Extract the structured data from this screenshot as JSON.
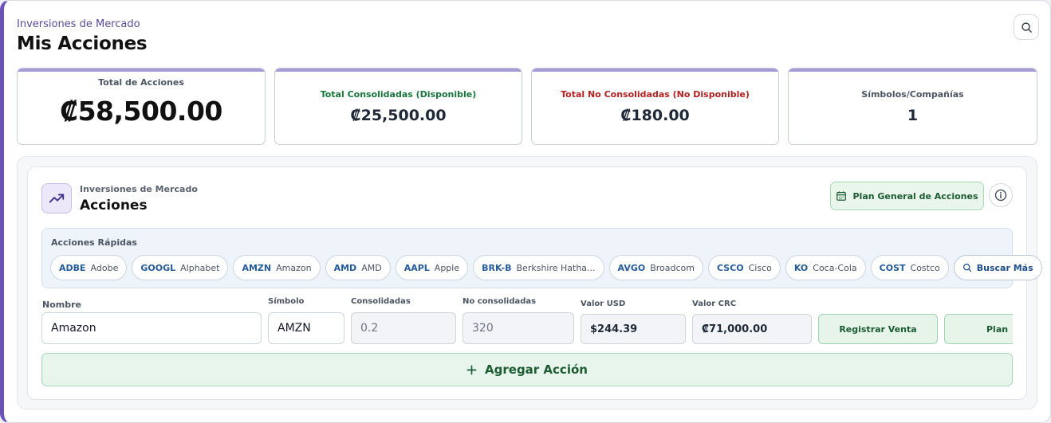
{
  "header": {
    "eyebrow": "Inversiones de Mercado",
    "title": "Mis Acciones"
  },
  "summary": {
    "total_label": "Total de Acciones",
    "total_value": "₡58,500.00",
    "consolidated_label": "Total Consolidadas (Disponible)",
    "consolidated_value": "₡25,500.00",
    "unconsolidated_label": "Total No Consolidadas (No Disponible)",
    "unconsolidated_value": "₡180.00",
    "symbols_label": "Símbolos/Compañías",
    "symbols_value": "1"
  },
  "panel": {
    "eyebrow": "Inversiones de Mercado",
    "title": "Acciones",
    "plan_button": "Plan General de Acciones"
  },
  "quick": {
    "label": "Acciones Rápidas",
    "chips": [
      {
        "symbol": "ADBE",
        "name": "Adobe"
      },
      {
        "symbol": "GOOGL",
        "name": "Alphabet"
      },
      {
        "symbol": "AMZN",
        "name": "Amazon"
      },
      {
        "symbol": "AMD",
        "name": "AMD"
      },
      {
        "symbol": "AAPL",
        "name": "Apple"
      },
      {
        "symbol": "BRK-B",
        "name": "Berkshire Hatha..."
      },
      {
        "symbol": "AVGO",
        "name": "Broadcom"
      },
      {
        "symbol": "CSCO",
        "name": "Cisco"
      },
      {
        "symbol": "KO",
        "name": "Coca-Cola"
      },
      {
        "symbol": "COST",
        "name": "Costco"
      }
    ],
    "more_label": "Buscar Más"
  },
  "form": {
    "name_label": "Nombre",
    "name_value": "Amazon",
    "symbol_label": "Símbolo",
    "symbol_value": "AMZN",
    "consolidated_label": "Consolidadas",
    "consolidated_value": "0.2",
    "unconsolidated_label": "No consolidadas",
    "unconsolidated_value": "320",
    "usd_label": "Valor USD",
    "usd_value": "$244.39",
    "crc_label": "Valor CRC",
    "crc_value": "₡71,000.00",
    "sell_button": "Registrar Venta",
    "plan_button": "Plan"
  },
  "add_button": "Agregar Acción",
  "colors": {
    "accent": "#6a52b8",
    "green": "#17753c",
    "red": "#b32020"
  }
}
